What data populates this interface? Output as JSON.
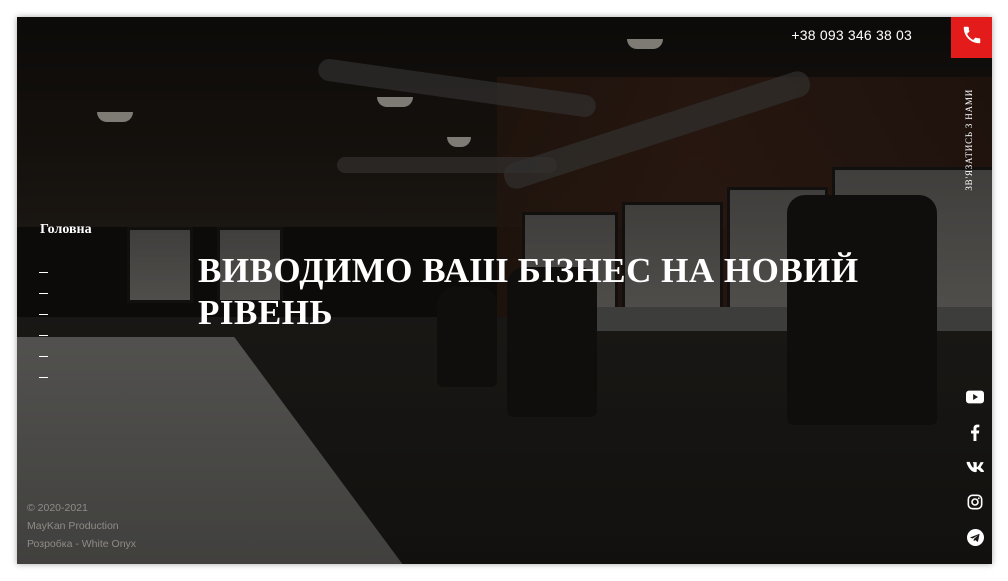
{
  "header": {
    "phone": "+38 093 346 38 03",
    "contact_label": "Зв'язатись з нами"
  },
  "nav": {
    "active_label": "Головна",
    "dash_count": 6
  },
  "hero": {
    "headline": "ВИВОДИМО ВАШ БІЗНЕС НА НОВИЙ РІВЕНЬ"
  },
  "footer": {
    "copyright": "© 2020-2021",
    "company": "MayKan Production",
    "developer": "Розробка - White Onyx"
  },
  "socials": [
    "youtube-icon",
    "facebook-icon",
    "vk-icon",
    "instagram-icon",
    "telegram-icon"
  ],
  "colors": {
    "accent": "#e31b1b",
    "text": "#ffffff",
    "footer_text": "#8f8c87"
  }
}
